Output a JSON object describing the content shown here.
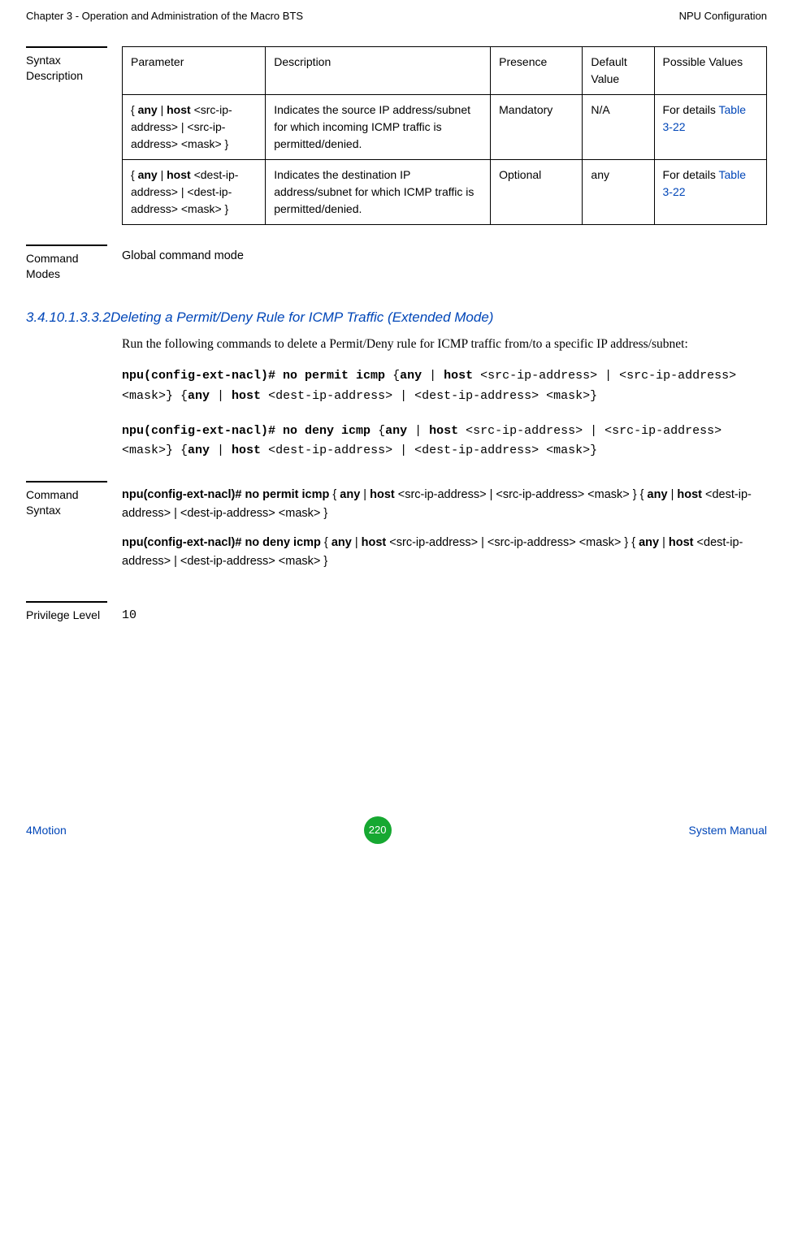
{
  "header": {
    "left": "Chapter 3 - Operation and Administration of the Macro BTS",
    "right": "NPU Configuration"
  },
  "syntax_description": {
    "label": "Syntax Description",
    "headers": {
      "param": "Parameter",
      "desc": "Description",
      "presence": "Presence",
      "default": "Default Value",
      "possible": "Possible Values"
    },
    "rows": [
      {
        "param_pre": "{ ",
        "param_bold1": "any",
        "param_sep1": " | ",
        "param_bold2": "host",
        "param_rest": " <src-ip-address> | <src-ip-address> <mask> }",
        "desc": "Indicates the source IP address/subnet for which incoming ICMP traffic is permitted/denied.",
        "presence": "Mandatory",
        "default": "N/A",
        "possible_text": "For details ",
        "possible_link": "Table 3-22"
      },
      {
        "param_pre": "{ ",
        "param_bold1": "any",
        "param_sep1": " | ",
        "param_bold2": "host",
        "param_rest": " <dest-ip-address> | <dest-ip-address> <mask> }",
        "desc": "Indicates the destination IP address/subnet for which ICMP traffic is permitted/denied.",
        "presence": "Optional",
        "default": "any",
        "possible_text": "For details ",
        "possible_link": "Table 3-22"
      }
    ]
  },
  "command_modes": {
    "label": "Command Modes",
    "value": "Global command mode"
  },
  "subsection": {
    "number": "3.4.10.1.3.3.2",
    "title": "Deleting a Permit/Deny Rule for ICMP Traffic (Extended Mode)",
    "intro": "Run the following commands to delete a Permit/Deny rule for ICMP traffic from/to a specific IP address/subnet:",
    "cmd1_b1": "npu(config-ext-nacl)# no permit icmp",
    "cmd1_t1": " {",
    "cmd1_b2": "any",
    "cmd1_t2": " | ",
    "cmd1_b3": "host",
    "cmd1_t3": " <src-ip-address> | <src-ip-address> <mask>} {",
    "cmd1_b4": "any",
    "cmd1_t4": " | ",
    "cmd1_b5": "host",
    "cmd1_t5": " <dest-ip-address> | <dest-ip-address> <mask>}",
    "cmd2_b1": "npu(config-ext-nacl)# no deny icmp",
    "cmd2_t1": " {",
    "cmd2_b2": "any",
    "cmd2_t2": " | ",
    "cmd2_b3": "host",
    "cmd2_t3": " <src-ip-address> | <src-ip-address> <mask>} {",
    "cmd2_b4": "any",
    "cmd2_t4": " | ",
    "cmd2_b5": "host",
    "cmd2_t5": " <dest-ip-address> | <dest-ip-address> <mask>}"
  },
  "command_syntax": {
    "label": "Command Syntax",
    "line1_b1": "npu(config-ext-nacl)# no permit icmp",
    "line1_t1": " { ",
    "line1_b2": "any",
    "line1_t2": " | ",
    "line1_b3": "host",
    "line1_t3": " <src-ip-address> | <src-ip-address> <mask> } { ",
    "line1_b4": "any",
    "line1_t4": " | ",
    "line1_b5": "host",
    "line1_t5": " <dest-ip-address> | <dest-ip-address> <mask> }",
    "line2_b1": "npu(config-ext-nacl)# no deny icmp",
    "line2_t1": " { ",
    "line2_b2": "any",
    "line2_t2": " | ",
    "line2_b3": "host",
    "line2_t3": " <src-ip-address> | <src-ip-address> <mask> }  { ",
    "line2_b4": "any",
    "line2_t4": " | ",
    "line2_b5": "host",
    "line2_t5": " <dest-ip-address> | <dest-ip-address> <mask> }"
  },
  "privilege": {
    "label": "Privilege Level",
    "value": "10"
  },
  "footer": {
    "left": "4Motion",
    "page": "220",
    "right": "System Manual"
  }
}
